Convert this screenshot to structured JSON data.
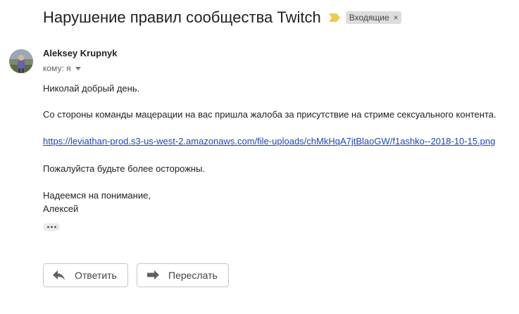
{
  "email": {
    "subject": "Нарушение правил сообщества Twitch",
    "label": "Входящие",
    "label_remove": "×",
    "sender_name": "Aleksey Krupnyk",
    "recipient": "кому: я",
    "body": {
      "greeting": "Николай добрый день.",
      "paragraph1": "Со стороны команды мацерации на вас пришла жалоба за присутствие на стриме сексуального контента.",
      "link": "https://leviathan-prod.s3-us-west-2.amazonaws.com/file-uploads/chMkHqA7jtBlaoGW/f1ashko--2018-10-15.png",
      "paragraph2": "Пожалуйста будьте более осторожны.",
      "closing": "Надеемся на понимание,",
      "signature": "Алексей"
    }
  },
  "actions": {
    "reply_label": "Ответить",
    "forward_label": "Переслать"
  },
  "icons": {
    "importance": "importance-marker-icon",
    "caret": "chevron-down-icon",
    "more": "more-horizontal-icon",
    "reply": "reply-icon",
    "forward": "forward-icon"
  },
  "colors": {
    "importance_marker": "#f2c94c",
    "link": "#1a47b8",
    "label_chip_bg": "#dddddd"
  }
}
